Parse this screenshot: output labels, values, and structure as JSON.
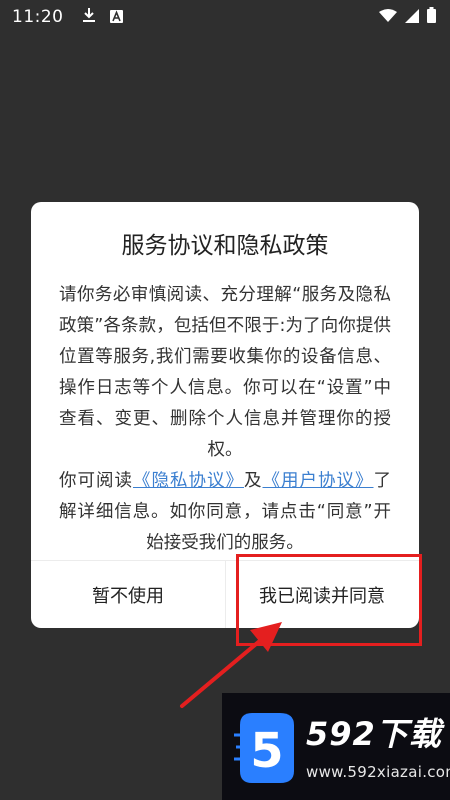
{
  "status_bar": {
    "time": "11:20",
    "left_icons": [
      "download-icon",
      "a-badge-icon"
    ],
    "right_icons": [
      "wifi-icon",
      "signal-icon",
      "battery-icon"
    ]
  },
  "dialog": {
    "title": "服务协议和隐私政策",
    "body": {
      "paragraph1": "请你务必审慎阅读、充分理解“服务及隐私政策”各条款，包括但不限于:为了向你提供位置等服务,我们需要收集你的设备信息、操作日志等个人信息。你可以在“设置”中查看、变更、删除个人信息并管理你的授权。",
      "p2_prefix": "你可阅读",
      "privacy_link": "《隐私协议》",
      "p2_and": "及",
      "user_link": "《用户协议》",
      "p2_suffix": "了解详细信息。如你同意，请点击“同意”开始接受我们的服务。"
    },
    "buttons": {
      "decline": "暂不使用",
      "agree": "我已阅读并同意"
    }
  },
  "watermark": {
    "logo_digit": "5",
    "brand": "592下载",
    "url": "www.592xiazai.com"
  },
  "colors": {
    "backdrop": "#2f2f2f",
    "link": "#3b7fd0",
    "highlight": "#e41f1f",
    "accent_blue": "#2a7fff"
  }
}
